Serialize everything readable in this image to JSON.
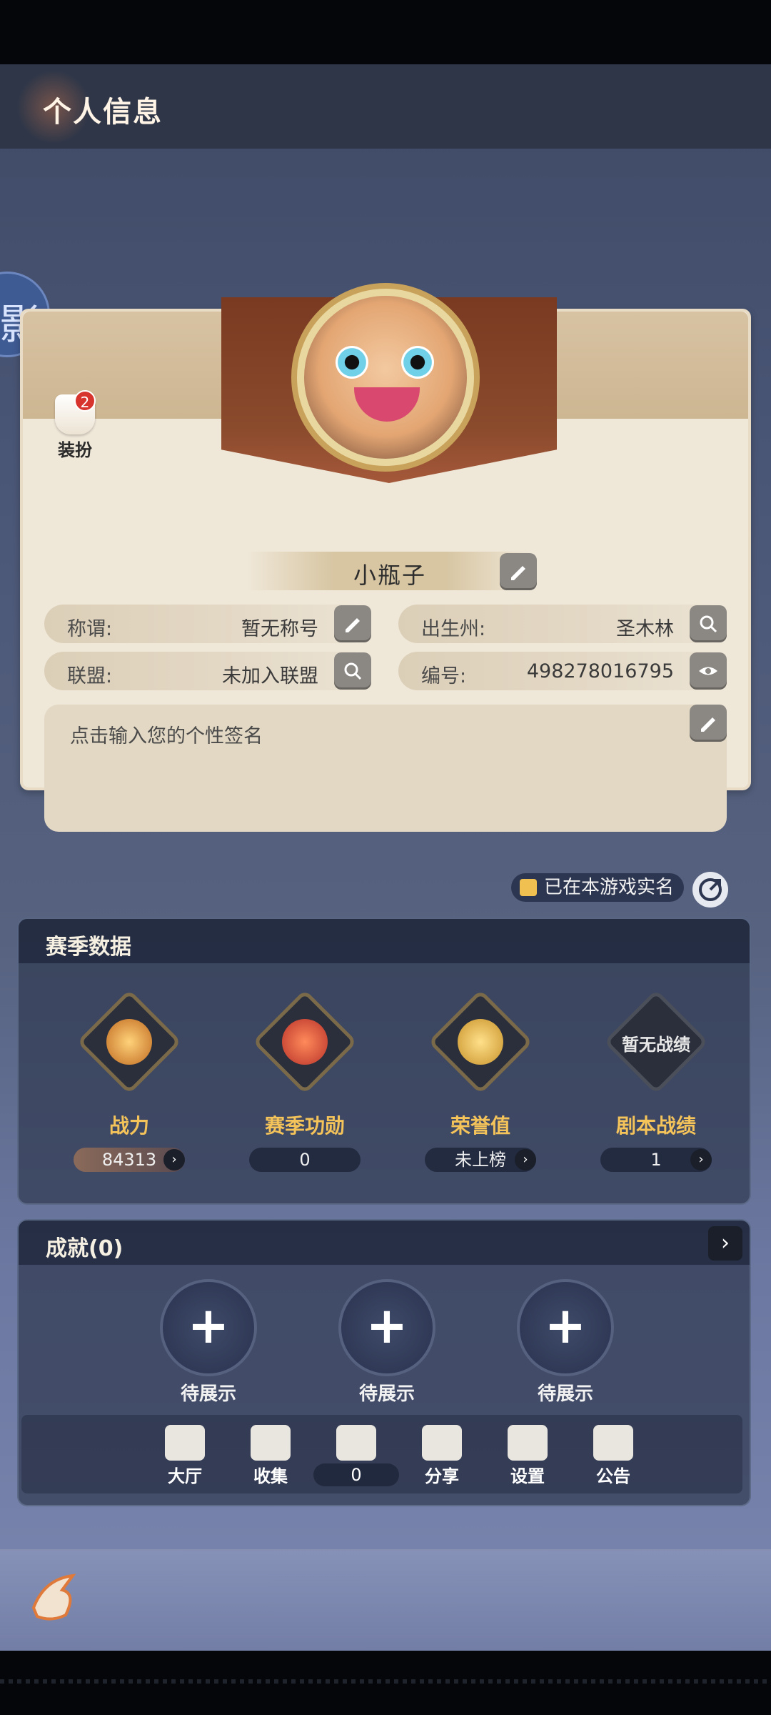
{
  "header": {
    "title": "个人信息"
  },
  "side_bubble": {
    "char": "影"
  },
  "profile": {
    "dress_up_label": "装扮",
    "dress_up_badge": "2",
    "nickname": "小瓶子",
    "fields": [
      {
        "key": "称谓:",
        "value": "暂无称号"
      },
      {
        "key": "出生州:",
        "value": "圣木林"
      },
      {
        "key": "联盟:",
        "value": "未加入联盟"
      },
      {
        "key": "编号:",
        "value": "498278016795"
      }
    ],
    "signature_placeholder": "点击输入您的个性签名",
    "realname_text": "已在本游戏实名"
  },
  "season": {
    "title": "赛季数据",
    "stats": [
      {
        "name": "战力",
        "value": "84313"
      },
      {
        "name": "赛季功勋",
        "value": "0"
      },
      {
        "name": "荣誉值",
        "value": "未上榜"
      },
      {
        "name": "剧本战绩",
        "value": "1"
      }
    ],
    "no_record_text": "暂无战绩"
  },
  "achievements": {
    "title": "成就(0)",
    "slots": [
      "待展示",
      "待展示",
      "待展示"
    ],
    "plus": "+"
  },
  "dock": {
    "items": [
      "大厅",
      "收集",
      "分享",
      "设置",
      "公告"
    ],
    "like_count": "0"
  },
  "icons": {
    "edit": "edit-icon",
    "search": "search-icon",
    "view": "eye-icon",
    "share": "share-icon",
    "next": "chevron-right-icon"
  },
  "colors": {
    "stat_label": "#f4c35a",
    "card_bg": "#efe7d8",
    "banner": "#8a4a2c",
    "badge": "#d8342e"
  }
}
